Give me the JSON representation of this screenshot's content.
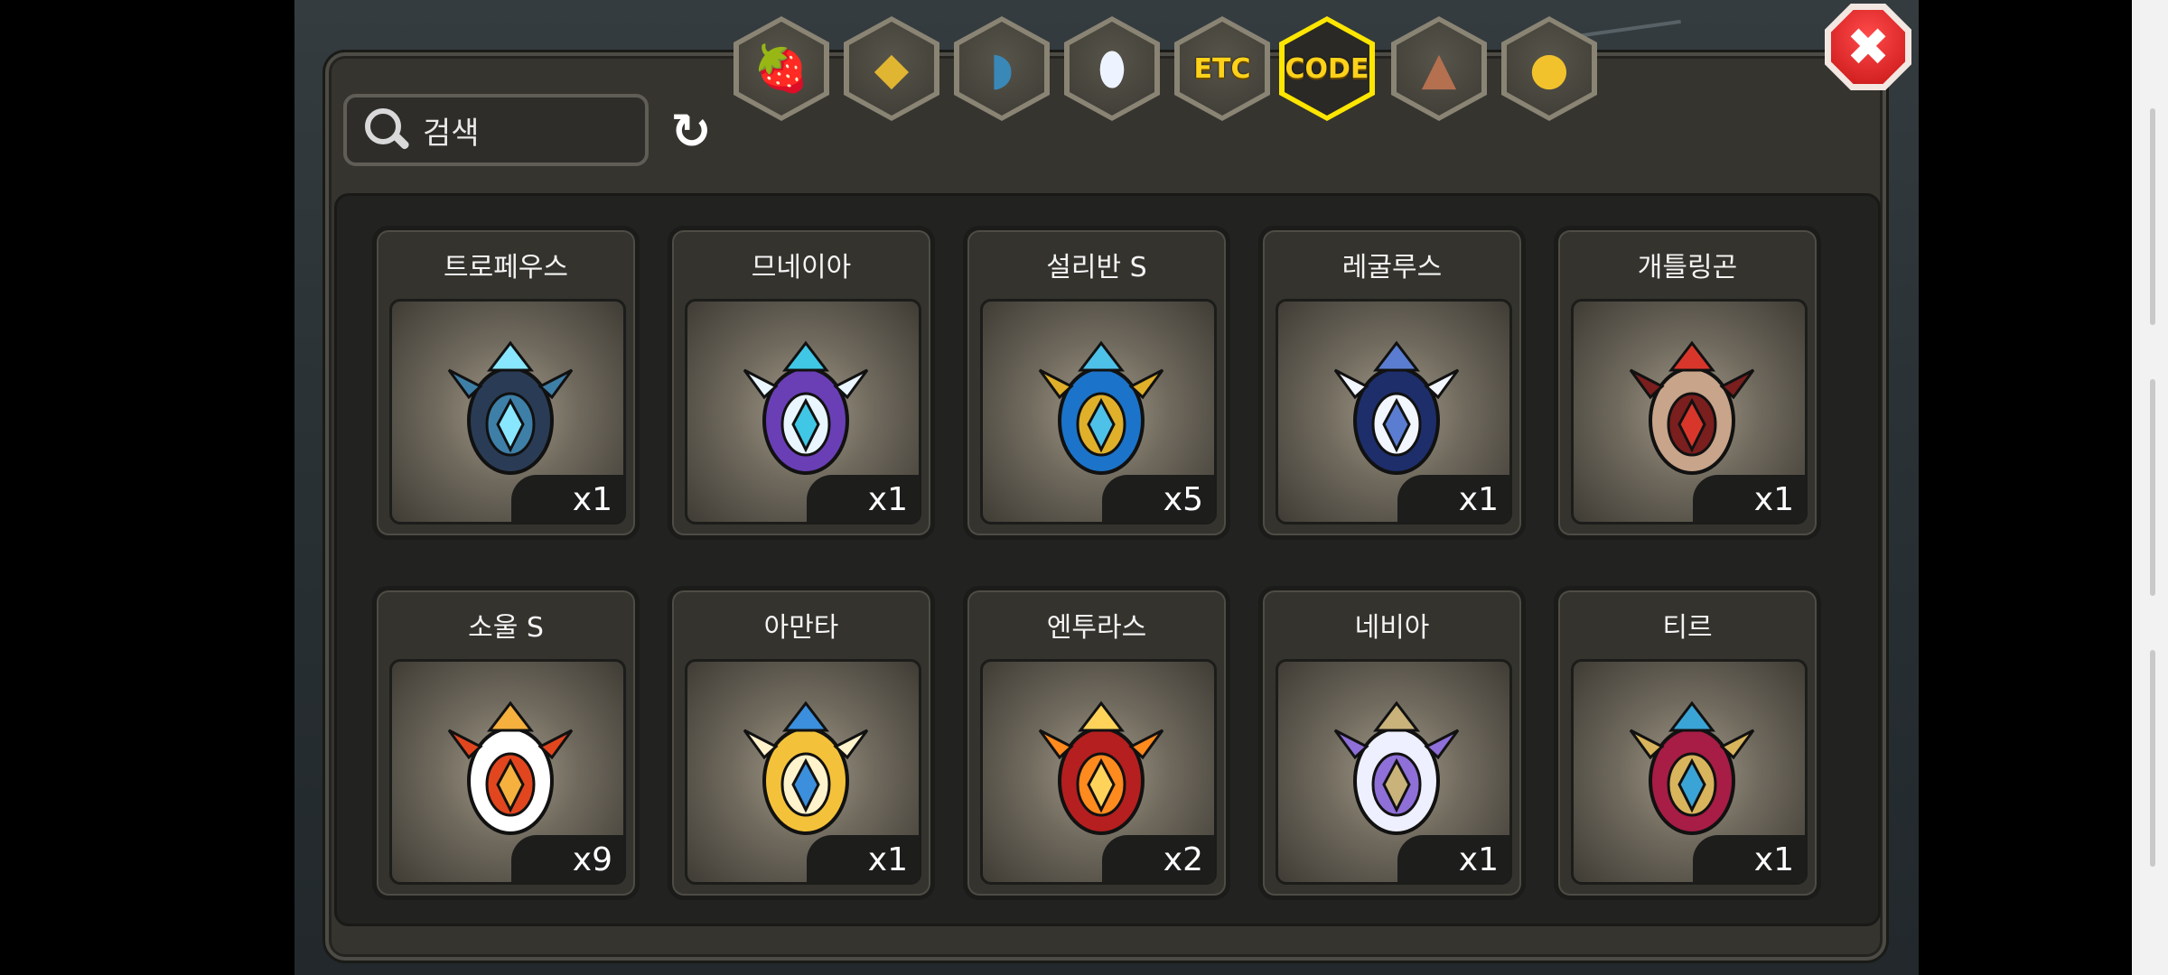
{
  "search": {
    "placeholder": "검색"
  },
  "refresh_icon": "refresh-icon",
  "tabs": [
    {
      "name": "fruit-tab",
      "icon": "red-fruit-icon"
    },
    {
      "name": "gold-tab",
      "icon": "gold-nugget-icon"
    },
    {
      "name": "blue-tab",
      "icon": "blue-scale-icon"
    },
    {
      "name": "egg-tab",
      "icon": "egg-icon"
    },
    {
      "name": "etc-tab",
      "label": "ETC"
    },
    {
      "name": "code-tab",
      "label": "CODE",
      "active": true
    },
    {
      "name": "beast-tab",
      "icon": "wolf-icon"
    },
    {
      "name": "mask-tab",
      "icon": "cat-mask-icon"
    }
  ],
  "items": [
    {
      "name": "트로페우스",
      "qty": "x1",
      "icon": "dark-spiked-egg",
      "colors": [
        "#2a3c55",
        "#3e7fa8",
        "#88e6ff"
      ]
    },
    {
      "name": "므네이아",
      "qty": "x1",
      "icon": "witch-hat-egg",
      "colors": [
        "#6a3fb5",
        "#e9f6ff",
        "#40c7e6"
      ]
    },
    {
      "name": "설리반 S",
      "qty": "x5",
      "icon": "peacock-egg",
      "colors": [
        "#1b74c9",
        "#e0b02a",
        "#4ec1e9"
      ]
    },
    {
      "name": "레굴루스",
      "qty": "x1",
      "icon": "diamond-egg",
      "colors": [
        "#1d2e6b",
        "#f2f6ff",
        "#5a7dd1"
      ]
    },
    {
      "name": "개틀링곤",
      "qty": "x1",
      "icon": "mech-egg",
      "colors": [
        "#c7a48a",
        "#7a1e1e",
        "#d9362b"
      ]
    },
    {
      "name": "소울 S",
      "qty": "x9",
      "icon": "flame-wing-egg",
      "colors": [
        "#ffffff",
        "#e2461e",
        "#f5b03d"
      ]
    },
    {
      "name": "아만타",
      "qty": "x1",
      "icon": "golden-crest-egg",
      "colors": [
        "#f4c23a",
        "#fff3cc",
        "#3b8fdc"
      ]
    },
    {
      "name": "엔투라스",
      "qty": "x2",
      "icon": "fire-egg",
      "colors": [
        "#b51f1f",
        "#ff8a1e",
        "#ffd35a"
      ]
    },
    {
      "name": "네비아",
      "qty": "x1",
      "icon": "winged-pearl-egg",
      "colors": [
        "#eef0ff",
        "#8f6fd8",
        "#c9b37a"
      ]
    },
    {
      "name": "티르",
      "qty": "x1",
      "icon": "crimson-horn-egg",
      "colors": [
        "#a71d45",
        "#d8b45c",
        "#3aa4d6"
      ]
    }
  ],
  "close_icon": "close-icon"
}
